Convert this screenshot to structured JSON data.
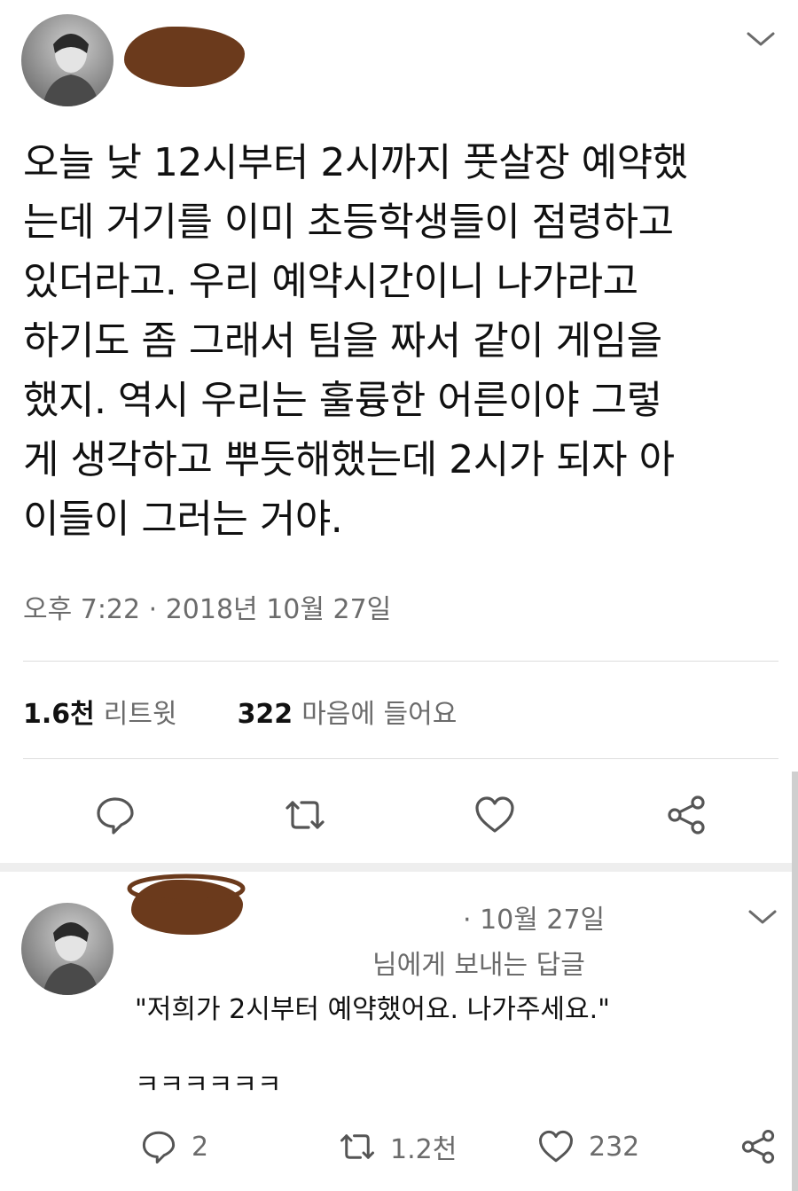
{
  "tweet": {
    "avatar_icon": "user-avatar",
    "text": "오늘 낮 12시부터 2시까지 풋살장 예약했\n는데 거기를 이미 초등학생들이 점령하고\n있더라고. 우리 예약시간이니 나가라고\n하기도 좀 그래서 팀을 짜서 같이 게임을\n했지. 역시 우리는 훌륭한 어른이야 그렇\n게 생각하고 뿌듯해했는데 2시가 되자 아\n이들이 그러는 거야.",
    "timestamp": "오후 7:22 · 2018년 10월 27일",
    "stats": {
      "retweets_count": "1.6천",
      "retweets_label": "리트윗",
      "likes_count": "322",
      "likes_label": "마음에 들어요"
    },
    "actions": [
      "reply-icon",
      "retweet-icon",
      "like-icon",
      "share-icon"
    ]
  },
  "reply": {
    "avatar_icon": "user-avatar",
    "date": "· 10월 27일",
    "replying_to": "님에게 보내는 답글",
    "text": "\"저희가 2시부터 예약했어요. 나가주세요.\"",
    "laugh": "ㅋㅋㅋㅋㅋㅋ",
    "reply_count": "2",
    "retweet_count": "1.2천",
    "like_count": "232"
  },
  "colors": {
    "text": "#111111",
    "secondary": "#6b6b6b",
    "divider": "#dddddd",
    "redaction": "#6b3a1c"
  }
}
